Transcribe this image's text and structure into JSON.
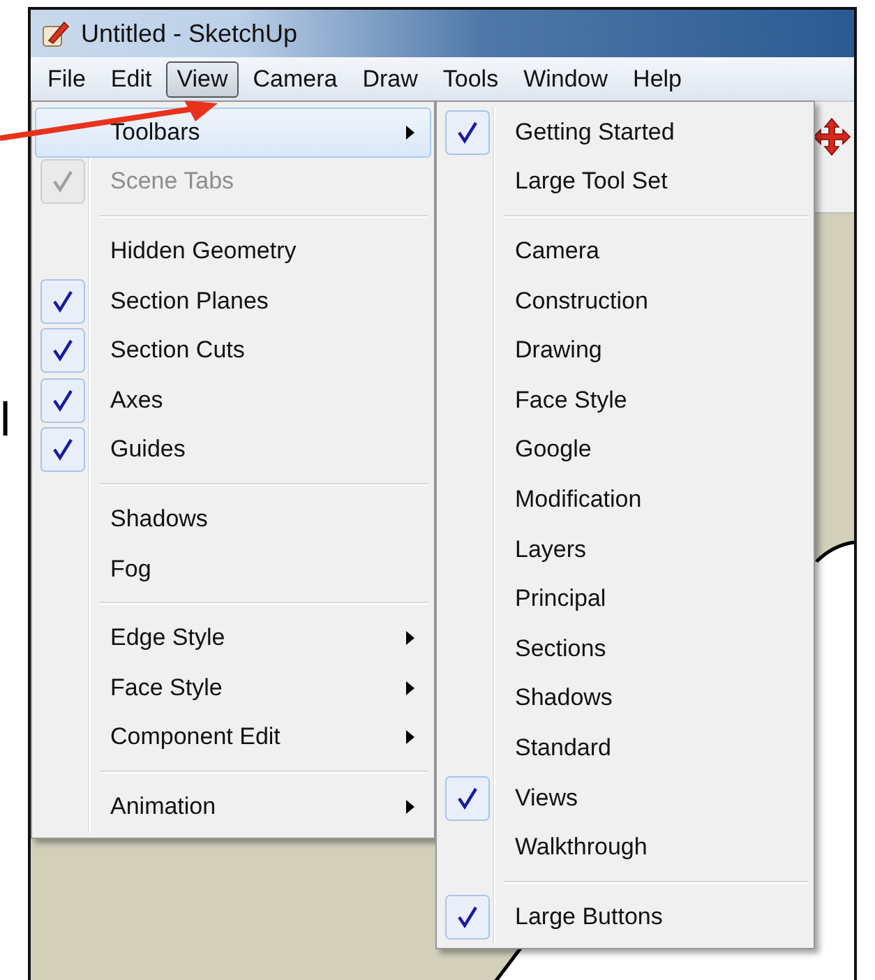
{
  "window": {
    "title": "Untitled - SketchUp"
  },
  "menu_bar": [
    {
      "label": "File",
      "selected": false
    },
    {
      "label": "Edit",
      "selected": false
    },
    {
      "label": "View",
      "selected": true
    },
    {
      "label": "Camera",
      "selected": false
    },
    {
      "label": "Draw",
      "selected": false
    },
    {
      "label": "Tools",
      "selected": false
    },
    {
      "label": "Window",
      "selected": false
    },
    {
      "label": "Help",
      "selected": false
    }
  ],
  "view_menu": {
    "items": [
      {
        "kind": "item",
        "label": "Toolbars",
        "selected": true,
        "checked": false,
        "disabled": false,
        "submenu": true
      },
      {
        "kind": "item",
        "label": "Scene Tabs",
        "selected": false,
        "checked": true,
        "disabled": true,
        "submenu": false
      },
      {
        "kind": "separator"
      },
      {
        "kind": "item",
        "label": "Hidden Geometry",
        "selected": false,
        "checked": false,
        "disabled": false,
        "submenu": false
      },
      {
        "kind": "item",
        "label": "Section Planes",
        "selected": false,
        "checked": true,
        "disabled": false,
        "submenu": false
      },
      {
        "kind": "item",
        "label": "Section Cuts",
        "selected": false,
        "checked": true,
        "disabled": false,
        "submenu": false
      },
      {
        "kind": "item",
        "label": "Axes",
        "selected": false,
        "checked": true,
        "disabled": false,
        "submenu": false
      },
      {
        "kind": "item",
        "label": "Guides",
        "selected": false,
        "checked": true,
        "disabled": false,
        "submenu": false
      },
      {
        "kind": "separator"
      },
      {
        "kind": "item",
        "label": "Shadows",
        "selected": false,
        "checked": false,
        "disabled": false,
        "submenu": false
      },
      {
        "kind": "item",
        "label": "Fog",
        "selected": false,
        "checked": false,
        "disabled": false,
        "submenu": false
      },
      {
        "kind": "separator"
      },
      {
        "kind": "item",
        "label": "Edge Style",
        "selected": false,
        "checked": false,
        "disabled": false,
        "submenu": true
      },
      {
        "kind": "item",
        "label": "Face Style",
        "selected": false,
        "checked": false,
        "disabled": false,
        "submenu": true
      },
      {
        "kind": "item",
        "label": "Component Edit",
        "selected": false,
        "checked": false,
        "disabled": false,
        "submenu": true
      },
      {
        "kind": "separator"
      },
      {
        "kind": "item",
        "label": "Animation",
        "selected": false,
        "checked": false,
        "disabled": false,
        "submenu": true
      }
    ]
  },
  "toolbars_submenu": {
    "items": [
      {
        "kind": "item",
        "label": "Getting Started",
        "selected": false,
        "checked": true
      },
      {
        "kind": "item",
        "label": "Large Tool Set",
        "selected": false,
        "checked": false
      },
      {
        "kind": "separator"
      },
      {
        "kind": "item",
        "label": "Camera",
        "selected": false,
        "checked": false
      },
      {
        "kind": "item",
        "label": "Construction",
        "selected": false,
        "checked": false
      },
      {
        "kind": "item",
        "label": "Drawing",
        "selected": false,
        "checked": false
      },
      {
        "kind": "item",
        "label": "Face Style",
        "selected": false,
        "checked": false
      },
      {
        "kind": "item",
        "label": "Google",
        "selected": false,
        "checked": false
      },
      {
        "kind": "item",
        "label": "Modification",
        "selected": false,
        "checked": false
      },
      {
        "kind": "item",
        "label": "Layers",
        "selected": false,
        "checked": false
      },
      {
        "kind": "item",
        "label": "Principal",
        "selected": false,
        "checked": false
      },
      {
        "kind": "item",
        "label": "Sections",
        "selected": false,
        "checked": false
      },
      {
        "kind": "item",
        "label": "Shadows",
        "selected": false,
        "checked": false
      },
      {
        "kind": "item",
        "label": "Standard",
        "selected": false,
        "checked": false
      },
      {
        "kind": "item",
        "label": "Views",
        "selected": false,
        "checked": true
      },
      {
        "kind": "item",
        "label": "Walkthrough",
        "selected": false,
        "checked": false
      },
      {
        "kind": "separator"
      },
      {
        "kind": "item",
        "label": "Large Buttons",
        "selected": false,
        "checked": true
      }
    ]
  },
  "side_text": "l"
}
